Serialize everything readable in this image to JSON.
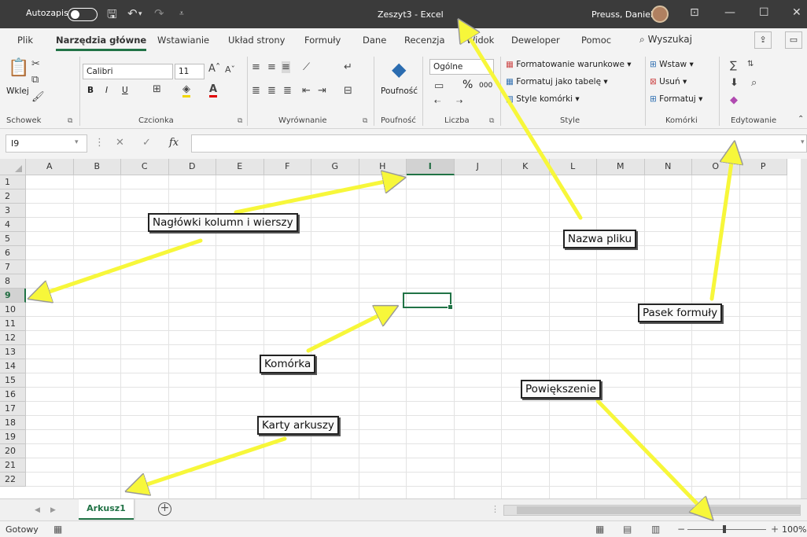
{
  "titlebar": {
    "autosave_label": "Autozapis",
    "doc_title": "Zeszyt3 - Excel",
    "user_name": "Preuss, Daniel"
  },
  "ribbon_tabs": [
    "Plik",
    "Narzędzia główne",
    "Wstawianie",
    "Układ strony",
    "Formuły",
    "Dane",
    "Recenzja",
    "Widok",
    "Deweloper",
    "Pomoc"
  ],
  "search_label": "Wyszukaj",
  "ribbon": {
    "clipboard": {
      "paste_label": "Wklej",
      "group": "Schowek"
    },
    "font": {
      "name": "Calibri",
      "size": "11",
      "bold": "B",
      "italic": "I",
      "underline": "U",
      "group": "Czcionka"
    },
    "alignment": {
      "group": "Wyrównanie"
    },
    "sensitivity": {
      "label": "Poufność",
      "group": "Poufność"
    },
    "number": {
      "format": "Ogólne",
      "percent": "%",
      "thousands": "000",
      "group": "Liczba"
    },
    "styles": {
      "conditional": "Formatowanie warunkowe",
      "as_table": "Formatuj jako tabelę",
      "cell_styles": "Style komórki",
      "group": "Style"
    },
    "cells": {
      "insert": "Wstaw",
      "delete": "Usuń",
      "format": "Formatuj",
      "group": "Komórki"
    },
    "editing": {
      "group": "Edytowanie"
    }
  },
  "formula_bar": {
    "name_box": "I9",
    "fx": "fx",
    "formula": ""
  },
  "columns": [
    "A",
    "B",
    "C",
    "D",
    "E",
    "F",
    "G",
    "H",
    "I",
    "J",
    "K",
    "L",
    "M",
    "N",
    "O",
    "P"
  ],
  "rows": [
    "1",
    "2",
    "3",
    "4",
    "5",
    "6",
    "7",
    "8",
    "9",
    "10",
    "11",
    "12",
    "13",
    "14",
    "15",
    "16",
    "17",
    "18",
    "19",
    "20",
    "21",
    "22"
  ],
  "selected_cell": {
    "column": "I",
    "row": "9"
  },
  "sheet_tabs": [
    "Arkusz1"
  ],
  "status": {
    "ready": "Gotowy",
    "zoom": "100%"
  },
  "annotations": {
    "headers": "Nagłówki kolumn i wierszy",
    "filename": "Nazwa pliku",
    "formula_bar": "Pasek formuły",
    "cell": "Komórka",
    "zoom": "Powiększenie",
    "sheet_tabs": "Karty arkuszy"
  },
  "colors": {
    "excel_green": "#217346",
    "title_bar": "#3b3b3b",
    "annotation_arrow": "#f7f73a"
  }
}
